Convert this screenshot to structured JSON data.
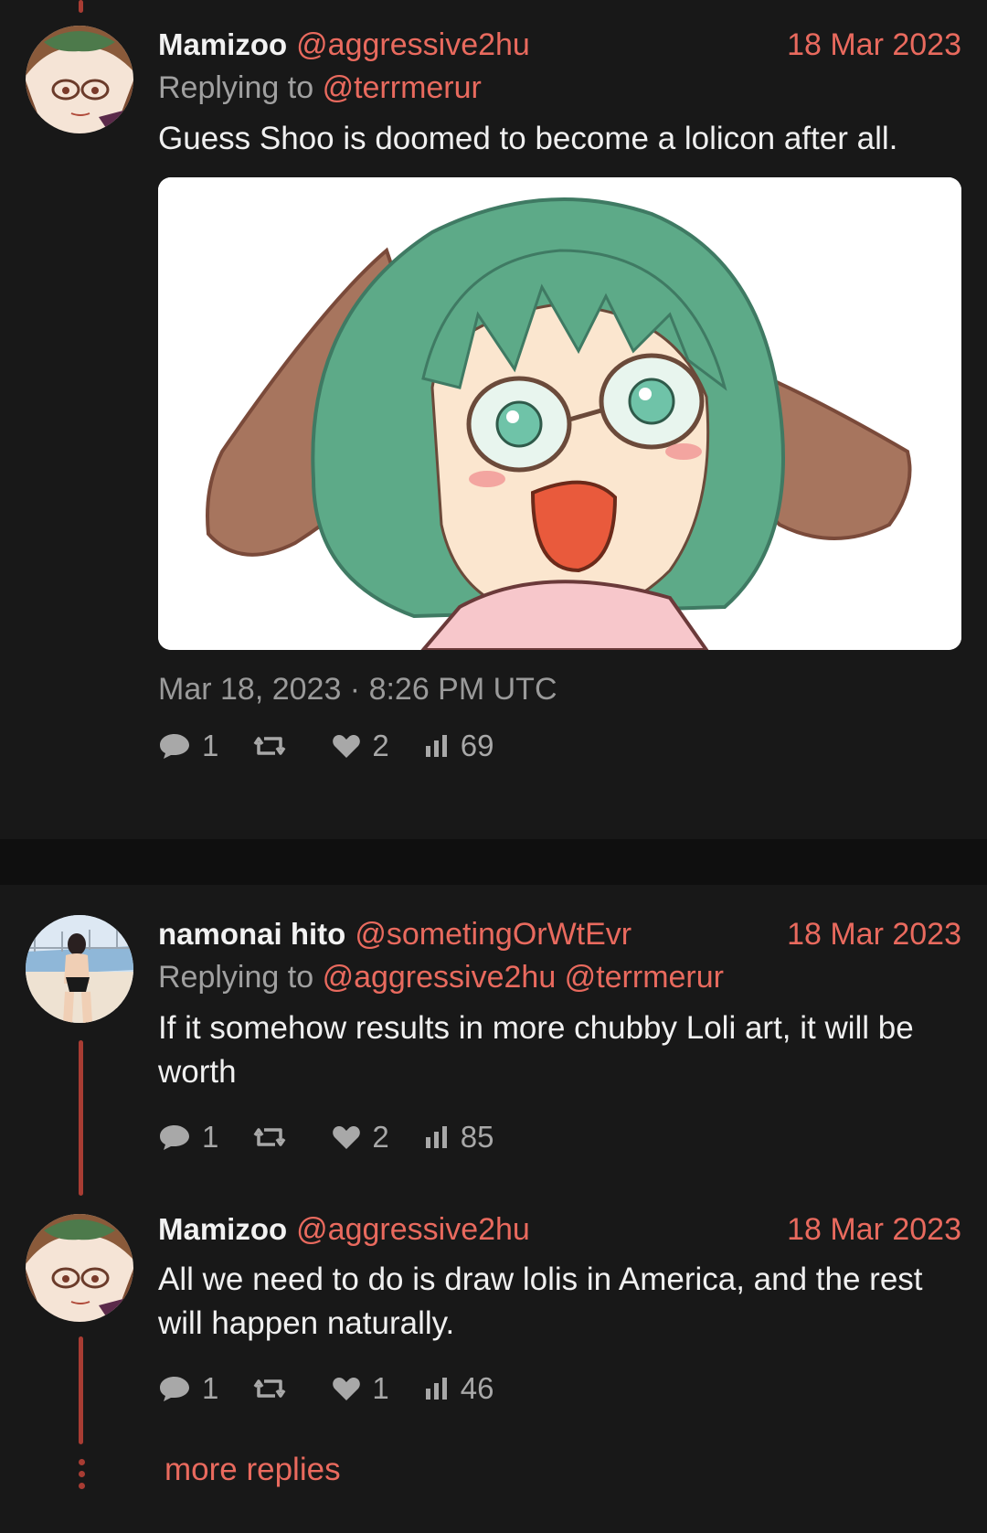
{
  "tweets": [
    {
      "name": "Mamizoo",
      "handle": "@aggressive2hu",
      "date": "18 Mar 2023",
      "replying_prefix": "Replying to",
      "replying_to": "@terrmerur",
      "text": "Guess Shoo is doomed to become a lolicon after all.",
      "timestamp": "Mar 18, 2023 · 8:26 PM UTC",
      "stats": {
        "replies": "1",
        "retweets": "",
        "likes": "2",
        "views": "69"
      }
    },
    {
      "name": "namonai hito",
      "handle": "@sometingOrWtEvr",
      "date": "18 Mar 2023",
      "replying_prefix": "Replying to",
      "replying_to": "@aggressive2hu @terrmerur",
      "text": "If it somehow results in more chubby Loli art, it will be worth",
      "stats": {
        "replies": "1",
        "retweets": "",
        "likes": "2",
        "views": "85"
      }
    },
    {
      "name": "Mamizoo",
      "handle": "@aggressive2hu",
      "date": "18 Mar 2023",
      "text": "All we need to do is draw lolis in America, and the rest will happen naturally.",
      "stats": {
        "replies": "1",
        "retweets": "",
        "likes": "1",
        "views": "46"
      }
    }
  ],
  "more_replies": "more replies",
  "icons": {
    "reply": "comment-icon",
    "retweet": "retweet-icon",
    "like": "heart-icon",
    "views": "views-icon"
  },
  "colors": {
    "accent": "#e96a5e",
    "background": "#181818",
    "thread_line": "#a83c33"
  }
}
